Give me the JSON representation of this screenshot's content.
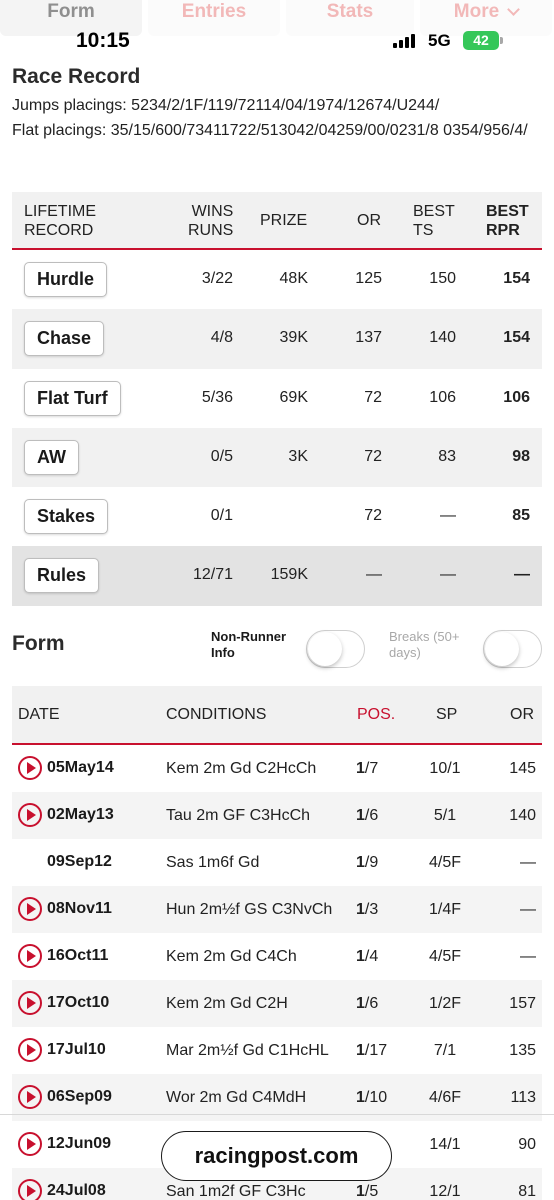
{
  "tabs": [
    {
      "label": "Form"
    },
    {
      "label": "Entries"
    },
    {
      "label": "Stats"
    },
    {
      "label": "More"
    }
  ],
  "status_bar": {
    "time": "10:15",
    "network": "5G",
    "battery": "42"
  },
  "race_record": {
    "title": "Race Record",
    "jumps_placings": "Jumps placings: 5234/2/1F/119/72114/04/1974/12674/U244/",
    "flat_placings": "Flat placings: 35/15/600/73411722/513042/04259/00/0231/8 0354/956/4/"
  },
  "lifetime": {
    "headers": {
      "record": [
        "LIFETIME",
        "RECORD"
      ],
      "wins_runs": [
        "WINS",
        "RUNS"
      ],
      "prize": "PRIZE",
      "or": "OR",
      "best_ts": [
        "BEST",
        "TS"
      ],
      "best_rpr": [
        "BEST",
        "RPR"
      ]
    },
    "rows": [
      {
        "type": "Hurdle",
        "wins_runs": "3/22",
        "prize": "48K",
        "or": "125",
        "best_ts": "150",
        "best_rpr": "154"
      },
      {
        "type": "Chase",
        "wins_runs": "4/8",
        "prize": "39K",
        "or": "137",
        "best_ts": "140",
        "best_rpr": "154"
      },
      {
        "type": "Flat Turf",
        "wins_runs": "5/36",
        "prize": "69K",
        "or": "72",
        "best_ts": "106",
        "best_rpr": "106"
      },
      {
        "type": "AW",
        "wins_runs": "0/5",
        "prize": "3K",
        "or": "72",
        "best_ts": "83",
        "best_rpr": "98"
      },
      {
        "type": "Stakes",
        "wins_runs": "0/1",
        "prize": "",
        "or": "72",
        "best_ts": "—",
        "best_rpr": "85"
      },
      {
        "type": "Rules",
        "wins_runs": "12/71",
        "prize": "159K",
        "or": "—",
        "best_ts": "—",
        "best_rpr": "—"
      }
    ]
  },
  "form": {
    "title": "Form",
    "non_runner_label": [
      "Non-Runner",
      "Info"
    ],
    "breaks_label": [
      "Breaks (50+",
      "days)"
    ],
    "non_runner_on": false,
    "breaks_on": false,
    "headers": {
      "date": "DATE",
      "conditions": "CONDITIONS",
      "pos": "POS.",
      "sp": "SP",
      "or": "OR"
    },
    "rows": [
      {
        "date": "05May14",
        "conditions": "Kem 2m Gd C2HcCh",
        "pos_main": "1",
        "pos_rest": "/7",
        "sp": "10/1",
        "or": "145",
        "video": true
      },
      {
        "date": "02May13",
        "conditions": "Tau 2m GF C3HcCh",
        "pos_main": "1",
        "pos_rest": "/6",
        "sp": "5/1",
        "or": "140",
        "video": true
      },
      {
        "date": "09Sep12",
        "conditions": "Sas 1m6f Gd",
        "pos_main": "1",
        "pos_rest": "/9",
        "sp": "4/5F",
        "or": "—",
        "video": false
      },
      {
        "date": "08Nov11",
        "conditions": "Hun 2m½f GS C3NvCh",
        "pos_main": "1",
        "pos_rest": "/3",
        "sp": "1/4F",
        "or": "—",
        "video": true
      },
      {
        "date": "16Oct11",
        "conditions": "Kem 2m Gd C4Ch",
        "pos_main": "1",
        "pos_rest": "/4",
        "sp": "4/5F",
        "or": "—",
        "video": true
      },
      {
        "date": "17Oct10",
        "conditions": "Kem 2m Gd C2H",
        "pos_main": "1",
        "pos_rest": "/6",
        "sp": "1/2F",
        "or": "157",
        "video": true
      },
      {
        "date": "17Jul10",
        "conditions": "Mar 2m½f Gd C1HcHL",
        "pos_main": "1",
        "pos_rest": "/17",
        "sp": "7/1",
        "or": "135",
        "video": true
      },
      {
        "date": "06Sep09",
        "conditions": "Wor 2m Gd C4MdH",
        "pos_main": "1",
        "pos_rest": "/10",
        "sp": "4/6F",
        "or": "113",
        "video": true
      },
      {
        "date": "12Jun09",
        "conditions": "",
        "pos_main": "",
        "pos_rest": "",
        "sp": "14/1",
        "or": "90",
        "video": true
      },
      {
        "date": "24Jul08",
        "conditions": "San 1m2f GF C3Hc",
        "pos_main": "1",
        "pos_rest": "/5",
        "sp": "12/1",
        "or": "81",
        "video": true
      }
    ]
  },
  "watermark": "racingpost.com",
  "colors": {
    "accent": "#c8102e",
    "battery": "#35c759"
  }
}
